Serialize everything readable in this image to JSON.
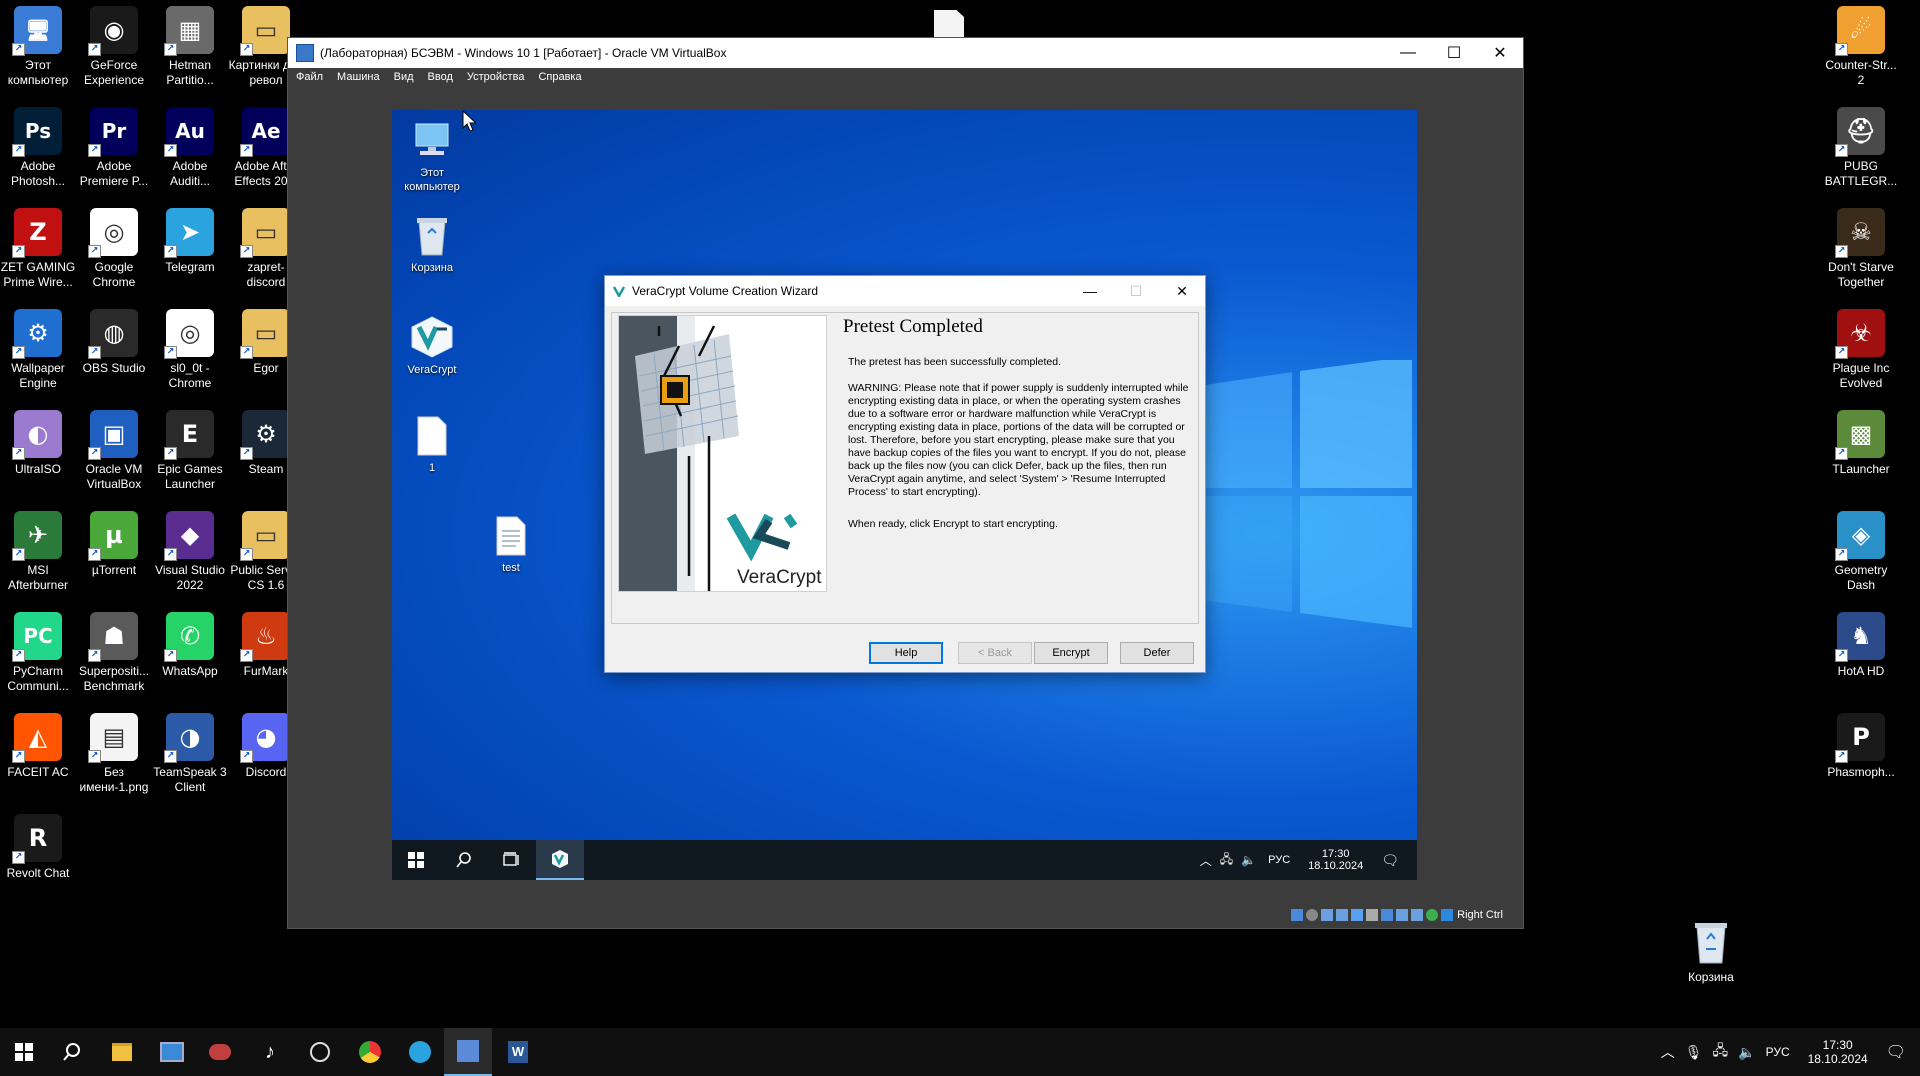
{
  "host_desktop": {
    "left_icons": [
      {
        "label": "Этот компьютер",
        "icon": "computer-icon",
        "color": "#3a7bd5",
        "glyph": "🖥"
      },
      {
        "label": "GeForce Experience",
        "icon": "geforce-icon",
        "color": "#1a1a1a",
        "glyph": "◉"
      },
      {
        "label": "Hetman Partitio...",
        "icon": "hetman-icon",
        "color": "#6a6a6a",
        "glyph": "▦"
      },
      {
        "label": "Картинки для револ",
        "icon": "folder-icon",
        "color": "#e8c060",
        "glyph": "▭"
      },
      {
        "label": "Adobe Photosh...",
        "icon": "photoshop-icon",
        "color": "#001e36",
        "glyph": "Ps"
      },
      {
        "label": "Adobe Premiere P...",
        "icon": "premiere-icon",
        "color": "#00005b",
        "glyph": "Pr"
      },
      {
        "label": "Adobe Auditi...",
        "icon": "audition-icon",
        "color": "#00005b",
        "glyph": "Au"
      },
      {
        "label": "Adobe After Effects 20...",
        "icon": "after-effects-icon",
        "color": "#00005b",
        "glyph": "Ae"
      },
      {
        "label": "ZET GAMING Prime Wire...",
        "icon": "zet-gaming-icon",
        "color": "#c01010",
        "glyph": "Z"
      },
      {
        "label": "Google Chrome",
        "icon": "chrome-icon",
        "color": "#ffffff",
        "glyph": "◎"
      },
      {
        "label": "Telegram",
        "icon": "telegram-icon",
        "color": "#2aa3df",
        "glyph": "➤"
      },
      {
        "label": "zapret-discord",
        "icon": "folder-icon",
        "color": "#e8c060",
        "glyph": "▭"
      },
      {
        "label": "Wallpaper Engine",
        "icon": "wallpaper-engine-icon",
        "color": "#1f6fd0",
        "glyph": "⚙"
      },
      {
        "label": "OBS Studio",
        "icon": "obs-icon",
        "color": "#2a2a2a",
        "glyph": "◍"
      },
      {
        "label": "sl0_0t - Chrome",
        "icon": "chrome-profile-icon",
        "color": "#ffffff",
        "glyph": "◎"
      },
      {
        "label": "Egor",
        "icon": "folder-icon",
        "color": "#e8c060",
        "glyph": "▭"
      },
      {
        "label": "UltraISO",
        "icon": "ultraiso-icon",
        "color": "#9a7bd0",
        "glyph": "◐"
      },
      {
        "label": "Oracle VM VirtualBox",
        "icon": "virtualbox-icon",
        "color": "#1f5fbf",
        "glyph": "▣"
      },
      {
        "label": "Epic Games Launcher",
        "icon": "epic-games-icon",
        "color": "#2a2a2a",
        "glyph": "E"
      },
      {
        "label": "Steam",
        "icon": "steam-icon",
        "color": "#1b2838",
        "glyph": "⚙"
      },
      {
        "label": "MSI Afterburner",
        "icon": "msi-afterburner-icon",
        "color": "#2a7a3a",
        "glyph": "✈"
      },
      {
        "label": "µTorrent",
        "icon": "utorrent-icon",
        "color": "#4aa83a",
        "glyph": "µ"
      },
      {
        "label": "Visual Studio 2022",
        "icon": "visual-studio-icon",
        "color": "#5c2d91",
        "glyph": "◆"
      },
      {
        "label": "Public Server CS 1.6",
        "icon": "folder-icon",
        "color": "#e8c060",
        "glyph": "▭"
      },
      {
        "label": "PyCharm Communi...",
        "icon": "pycharm-icon",
        "color": "#21d789",
        "glyph": "PC"
      },
      {
        "label": "Superpositi... Benchmark",
        "icon": "superposition-icon",
        "color": "#5a5a5a",
        "glyph": "☗"
      },
      {
        "label": "WhatsApp",
        "icon": "whatsapp-icon",
        "color": "#25d366",
        "glyph": "✆"
      },
      {
        "label": "FurMark",
        "icon": "furmark-icon",
        "color": "#d03a10",
        "glyph": "♨"
      },
      {
        "label": "FACEIT AC",
        "icon": "faceit-icon",
        "color": "#ff5500",
        "glyph": "◭"
      },
      {
        "label": "Без имени-1.png",
        "icon": "image-file-icon",
        "color": "#f4f4f4",
        "glyph": "▤"
      },
      {
        "label": "TeamSpeak 3 Client",
        "icon": "teamspeak-icon",
        "color": "#2a5aa8",
        "glyph": "◑"
      },
      {
        "label": "Discord",
        "icon": "discord-icon",
        "color": "#5865f2",
        "glyph": "◕"
      },
      {
        "label": "Revolt Chat",
        "icon": "revolt-icon",
        "color": "#1a1a1a",
        "glyph": "R"
      }
    ],
    "right_icons": [
      {
        "label": "Counter-Str... 2",
        "icon": "counter-strike-icon",
        "color": "#f0a030",
        "glyph": "☄"
      },
      {
        "label": "PUBG BATTLEGR...",
        "icon": "pubg-icon",
        "color": "#4a4a4a",
        "glyph": "⛑"
      },
      {
        "label": "Don't Starve Together",
        "icon": "dont-starve-icon",
        "color": "#3a2a1a",
        "glyph": "☠"
      },
      {
        "label": "Plague Inc Evolved",
        "icon": "plague-inc-icon",
        "color": "#a01010",
        "glyph": "☣"
      },
      {
        "label": "TLauncher",
        "icon": "tlauncher-icon",
        "color": "#5a8a3a",
        "glyph": "▩"
      },
      {
        "label": "Geometry Dash",
        "icon": "geometry-dash-icon",
        "color": "#2a90c8",
        "glyph": "◈"
      },
      {
        "label": "HotA HD",
        "icon": "hota-icon",
        "color": "#2a4a8a",
        "glyph": "♞"
      },
      {
        "label": "Phasmoph...",
        "icon": "phasmophobia-icon",
        "color": "#1a1a1a",
        "glyph": "P"
      }
    ],
    "recycle_bin": {
      "label": "Корзина"
    }
  },
  "vbox": {
    "title": "(Лабораторная) БСЭВМ - Windows 10 1 [Работает] - Oracle VM VirtualBox",
    "menu": [
      "Файл",
      "Машина",
      "Вид",
      "Ввод",
      "Устройства",
      "Справка"
    ],
    "host_key": "Right Ctrl"
  },
  "guest": {
    "icons": [
      {
        "label": "Этот компьютер"
      },
      {
        "label": "Корзина"
      },
      {
        "label": "VeraCrypt"
      },
      {
        "label": "1"
      },
      {
        "label": "test"
      }
    ],
    "taskbar": {
      "lang": "РУС",
      "time": "17:30",
      "date": "18.10.2024"
    }
  },
  "dialog": {
    "title": "VeraCrypt Volume Creation Wizard",
    "heading": "Pretest Completed",
    "para1": "The pretest has been successfully completed.",
    "para2": "WARNING: Please note that if power supply is suddenly interrupted while encrypting existing data in place, or when the operating system crashes due to a software error or hardware malfunction while VeraCrypt is encrypting existing data in place, portions of the data will be corrupted or lost. Therefore, before you start encrypting, please make sure that you have backup copies of the files you want to encrypt. If you do not, please back up the files now (you can click Defer, back up the files, then run VeraCrypt again anytime, and select 'System' > 'Resume Interrupted Process' to start encrypting).",
    "para3": "When ready, click Encrypt to start encrypting.",
    "brand": "VeraCrypt",
    "buttons": {
      "help": "Help",
      "back": "< Back",
      "encrypt": "Encrypt",
      "defer": "Defer"
    }
  },
  "host_taskbar": {
    "lang": "РУС",
    "time": "17:30",
    "date": "18.10.2024"
  }
}
